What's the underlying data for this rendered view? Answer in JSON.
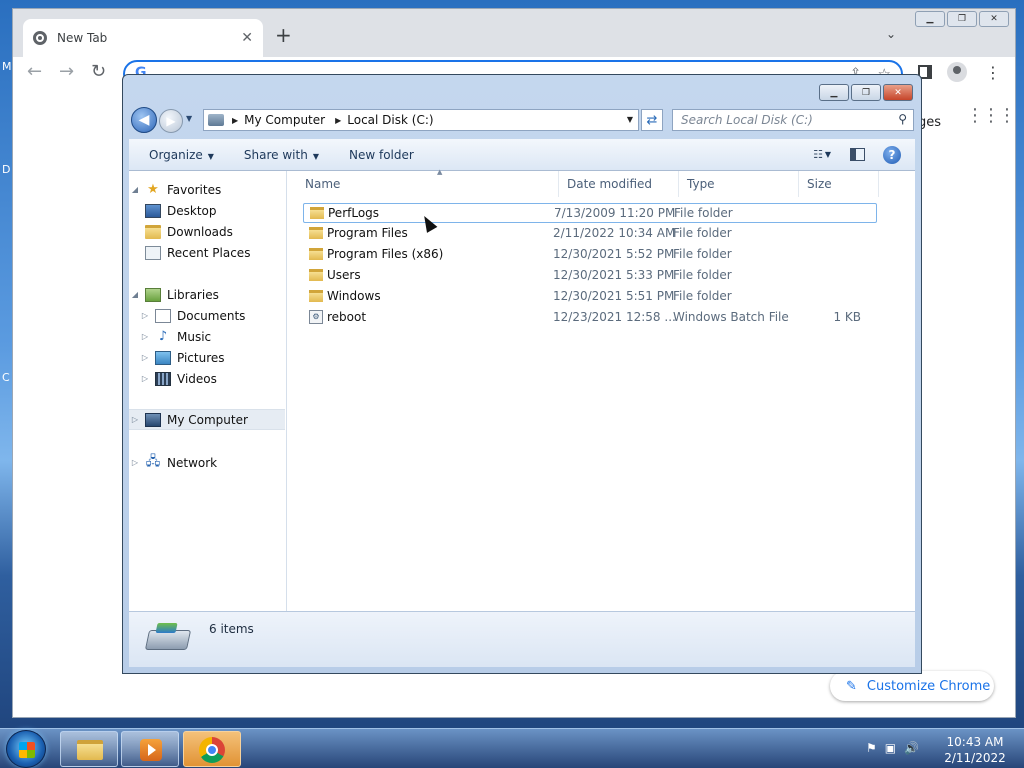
{
  "chrome": {
    "tab_title": "New Tab",
    "tab_close": "✕",
    "new_tab": "+",
    "tab_search": "⌄",
    "back": "←",
    "forward": "→",
    "reload": "↻",
    "omnibox_value": "",
    "omnibox_logo": "G",
    "images_link": "ges",
    "customize_label": "Customize Chrome",
    "window_controls": {
      "minimize": "▁",
      "restore": "❐",
      "close": "✕"
    }
  },
  "explorer": {
    "breadcrumb": [
      "My Computer",
      "Local Disk (C:)"
    ],
    "search_placeholder": "Search Local Disk (C:)",
    "toolbar": {
      "organize": "Organize",
      "share_with": "Share with",
      "new_folder": "New folder"
    },
    "columns": {
      "name": "Name",
      "date_modified": "Date modified",
      "type": "Type",
      "size": "Size"
    },
    "nav": {
      "favorites": "Favorites",
      "desktop": "Desktop",
      "downloads": "Downloads",
      "recent_places": "Recent Places",
      "libraries": "Libraries",
      "documents": "Documents",
      "music": "Music",
      "pictures": "Pictures",
      "videos": "Videos",
      "my_computer": "My Computer",
      "network": "Network"
    },
    "files": [
      {
        "name": "PerfLogs",
        "date": "7/13/2009 11:20 PM",
        "type": "File folder",
        "size": ""
      },
      {
        "name": "Program Files",
        "date": "2/11/2022 10:34 AM",
        "type": "File folder",
        "size": ""
      },
      {
        "name": "Program Files (x86)",
        "date": "12/30/2021 5:52 PM",
        "type": "File folder",
        "size": ""
      },
      {
        "name": "Users",
        "date": "12/30/2021 5:33 PM",
        "type": "File folder",
        "size": ""
      },
      {
        "name": "Windows",
        "date": "12/30/2021 5:51 PM",
        "type": "File folder",
        "size": ""
      },
      {
        "name": "reboot",
        "date": "12/23/2021 12:58 ...",
        "type": "Windows Batch File",
        "size": "1 KB"
      }
    ],
    "item_count": "6 items"
  },
  "taskbar": {
    "time": "10:43 AM",
    "date": "2/11/2022"
  }
}
